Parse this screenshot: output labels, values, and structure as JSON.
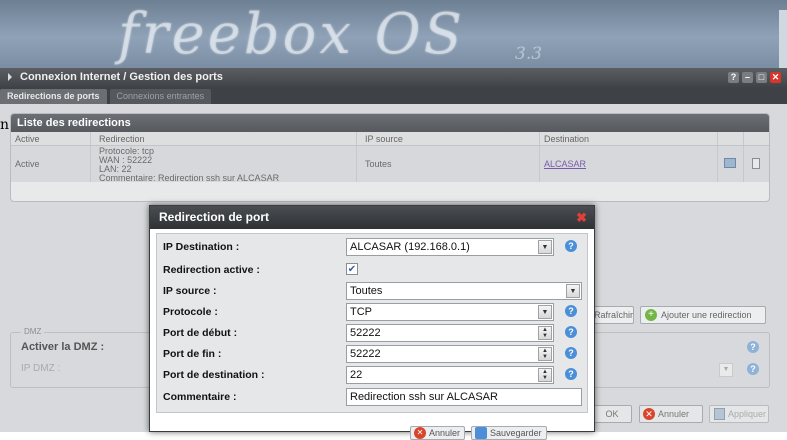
{
  "brand": {
    "logo": "freebox OS",
    "version": "3.3"
  },
  "window": {
    "title": "Connexion Internet / Gestion des ports",
    "controls": [
      "?",
      "–",
      "□",
      "✕"
    ],
    "tabs": [
      {
        "label": "Redirections de ports",
        "active": true
      },
      {
        "label": "Connexions entrantes",
        "active": false
      }
    ]
  },
  "cut_text": "n",
  "panel": {
    "title": "Liste des redirections",
    "columns": [
      "Active",
      "Redirection",
      "IP source",
      "Destination"
    ],
    "rows": [
      {
        "active": "Active",
        "redirection": [
          "Protocole: tcp",
          "WAN : 52222",
          "LAN: 22",
          "Commentaire: Redirection ssh sur ALCASAR"
        ],
        "ip_source": "Toutes",
        "destination": "ALCASAR"
      }
    ]
  },
  "buttons": {
    "refresh": "Rafraîchir",
    "add": "Ajouter une redirection",
    "ok": "OK",
    "cancel": "Annuler",
    "apply": "Appliquer"
  },
  "dmz": {
    "legend": "DMZ",
    "activate_label": "Activer la DMZ :",
    "ip_label": "IP DMZ :"
  },
  "dialog": {
    "title": "Redirection de port",
    "fields": {
      "ip_destination": {
        "label": "IP Destination :",
        "value": "ALCASAR (192.168.0.1)"
      },
      "redirection_active": {
        "label": "Redirection active :",
        "checked": true
      },
      "ip_source": {
        "label": "IP source :",
        "value": "Toutes"
      },
      "protocole": {
        "label": "Protocole :",
        "value": "TCP"
      },
      "port_debut": {
        "label": "Port de début :",
        "value": "52222"
      },
      "port_fin": {
        "label": "Port de fin :",
        "value": "52222"
      },
      "port_destination": {
        "label": "Port de destination :",
        "value": "22"
      },
      "commentaire": {
        "label": "Commentaire :",
        "value": "Redirection ssh sur ALCASAR"
      }
    },
    "footer": {
      "cancel": "Annuler",
      "save": "Sauvegarder"
    }
  },
  "colors": {
    "accent_help": "#4b8fd8",
    "close_red": "#d9342b",
    "add_green": "#74b548"
  }
}
